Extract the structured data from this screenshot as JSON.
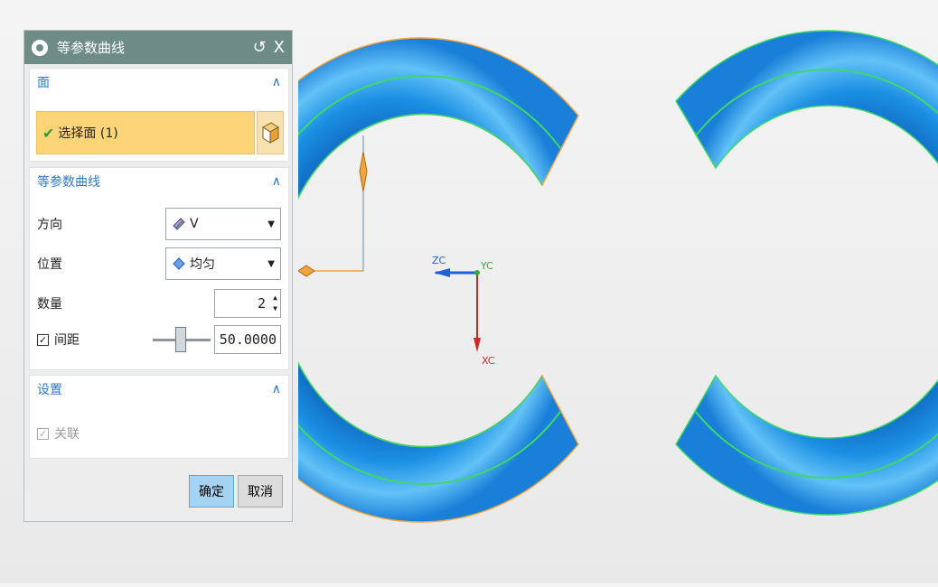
{
  "dialog": {
    "title": "等参数曲线",
    "reset_icon": "↺",
    "close_icon": "X"
  },
  "face_group": {
    "header": "面",
    "select_label": "选择面 (1)",
    "select_icon": "face-select-icon"
  },
  "curve_group": {
    "header": "等参数曲线",
    "direction_label": "方向",
    "direction_value": "V",
    "position_label": "位置",
    "position_value": "均匀",
    "count_label": "数量",
    "count_value": "2",
    "spacing_label": "间距",
    "spacing_checked": true,
    "spacing_value": "50.0000"
  },
  "settings_group": {
    "header": "设置",
    "associative_label": "关联",
    "associative_checked": true
  },
  "buttons": {
    "ok": "确定",
    "cancel": "取消"
  },
  "viewport": {
    "axis_zc": "ZC",
    "axis_yc": "YC",
    "axis_xc": "XC",
    "colors": {
      "torus": "#1e96e8",
      "isocurve": "#3bd86a",
      "edge": "#f0a640",
      "axis_z": "#1f5fd6",
      "axis_y": "#2fae3c",
      "axis_x": "#d62626"
    }
  }
}
